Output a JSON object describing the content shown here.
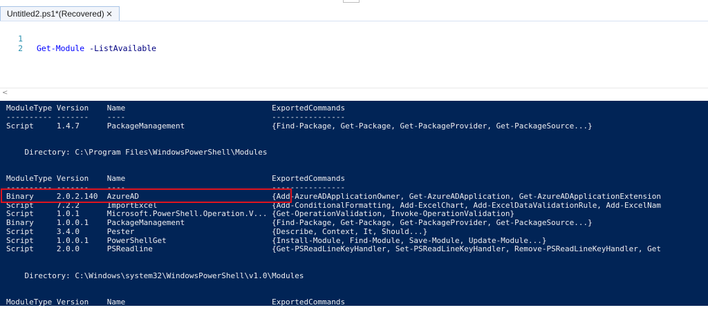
{
  "tab": {
    "title": "Untitled2.ps1*(Recovered)",
    "close_glyph": "×"
  },
  "editor": {
    "lines": [
      {
        "number": "1",
        "cmd": "Get-Module",
        "param": " -ListAvailable"
      },
      {
        "number": "2",
        "cmd": "",
        "param": ""
      }
    ]
  },
  "console": {
    "lines": [
      "ModuleType Version    Name                                ExportedCommands",
      "---------- -------    ----                                ----------------",
      "Script     1.4.7      PackageManagement                   {Find-Package, Get-Package, Get-PackageProvider, Get-PackageSource...}",
      "",
      "",
      "    Directory: C:\\Program Files\\WindowsPowerShell\\Modules",
      "",
      "",
      "ModuleType Version    Name                                ExportedCommands",
      "---------- -------    ----                                ----------------",
      "Binary     2.0.2.140  AzureAD                             {Add-AzureADApplicationOwner, Get-AzureADApplication, Get-AzureADApplicationExtension",
      "Script     7.2.2      ImportExcel                         {Add-ConditionalFormatting, Add-ExcelChart, Add-ExcelDataValidationRule, Add-ExcelNam",
      "Script     1.0.1      Microsoft.PowerShell.Operation.V... {Get-OperationValidation, Invoke-OperationValidation}",
      "Binary     1.0.0.1    PackageManagement                   {Find-Package, Get-Package, Get-PackageProvider, Get-PackageSource...}",
      "Script     3.4.0      Pester                              {Describe, Context, It, Should...}",
      "Script     1.0.0.1    PowerShellGet                       {Install-Module, Find-Module, Save-Module, Update-Module...}",
      "Script     2.0.0      PSReadline                          {Get-PSReadLineKeyHandler, Set-PSReadLineKeyHandler, Remove-PSReadLineKeyHandler, Get",
      "",
      "",
      "    Directory: C:\\Windows\\system32\\WindowsPowerShell\\v1.0\\Modules",
      "",
      "",
      "ModuleType Version    Name                                ExportedCommands"
    ]
  },
  "colors": {
    "console_bg": "#012456",
    "console_fg": "#eeedf0",
    "highlight_border": "#e0141e",
    "line_number": "#2b91af",
    "cmdlet": "#0000ff"
  },
  "icons": {
    "scroll_left": "scroll-left-arrow-icon"
  }
}
